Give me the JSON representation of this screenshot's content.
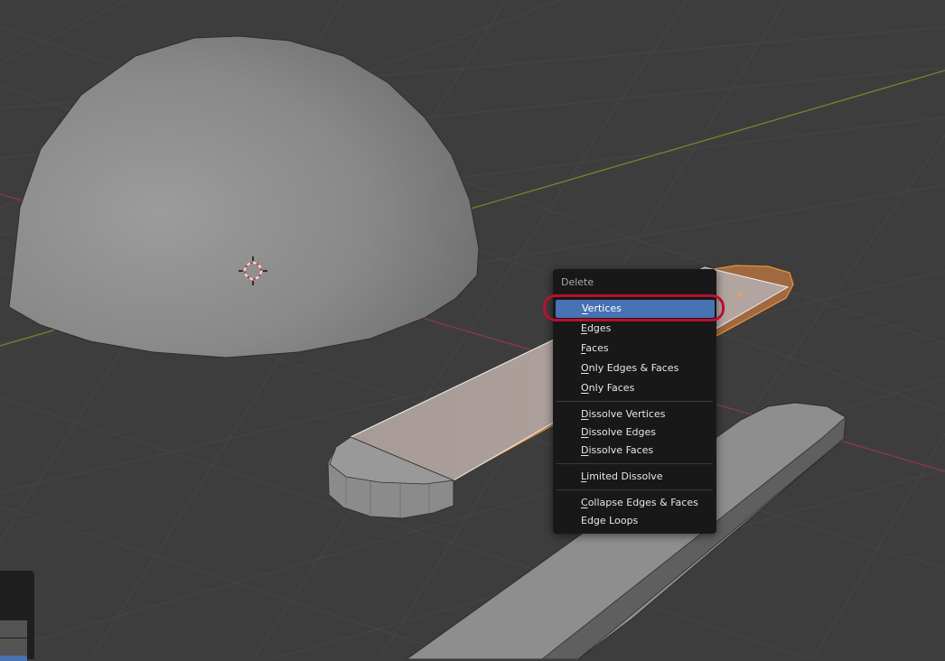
{
  "delete_menu": {
    "title": "Delete",
    "items": [
      {
        "label": "Vertices",
        "mnemonic": "V",
        "rest": "ertices",
        "active": true
      },
      {
        "label": "Edges",
        "mnemonic": "E",
        "rest": "dges"
      },
      {
        "label": "Faces",
        "mnemonic": "F",
        "rest": "aces"
      },
      {
        "label": "Only Edges & Faces",
        "mnemonic": "O",
        "rest": "nly Edges & Faces"
      },
      {
        "label": "Only Faces",
        "mnemonic": "O",
        "rest": "nly Faces"
      },
      {
        "label": "Dissolve Vertices",
        "mnemonic": "D",
        "rest": "issolve Vertices"
      },
      {
        "label": "Dissolve Edges",
        "mnemonic": "D",
        "rest": "issolve Edges"
      },
      {
        "label": "Dissolve Faces",
        "mnemonic": "D",
        "rest": "issolve Faces"
      },
      {
        "label": "Limited Dissolve",
        "mnemonic": "L",
        "rest": "imited Dissolve"
      },
      {
        "label": "Collapse Edges & Faces",
        "mnemonic": "C",
        "rest": "ollapse Edges & Faces"
      },
      {
        "label": "Edge Loops",
        "mnemonic": "E",
        "rest": "dge Loops"
      }
    ]
  },
  "colors": {
    "viewport_bg": "#3d3d3d",
    "grid": "#464646",
    "x_axis": "#8a3a45",
    "y_axis": "#6b8a2e",
    "selection_orange": "#e8923a",
    "menu_bg": "#181818",
    "menu_active": "#4772b3",
    "highlight_ring": "#b8102f"
  },
  "icons": {
    "cursor": "3d-cursor-icon"
  }
}
